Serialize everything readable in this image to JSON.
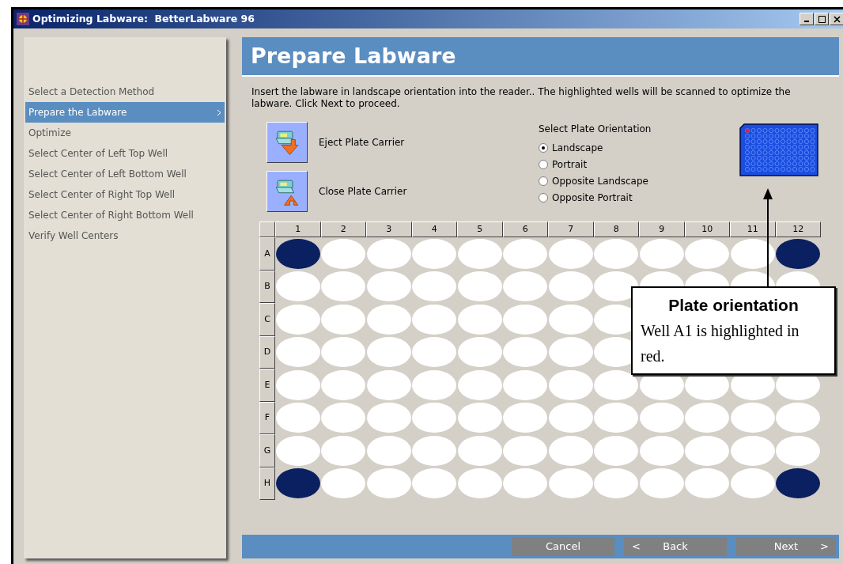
{
  "window": {
    "title": "Optimizing Labware:  BetterLabware 96"
  },
  "steps": [
    {
      "label": "Select a Detection Method",
      "selected": false
    },
    {
      "label": "Prepare the Labware",
      "selected": true
    },
    {
      "label": "Optimize",
      "selected": false
    },
    {
      "label": "Select Center of Left Top Well",
      "selected": false
    },
    {
      "label": "Select Center of Left Bottom Well",
      "selected": false
    },
    {
      "label": "Select Center of Right Top Well",
      "selected": false
    },
    {
      "label": "Select Center of Right Bottom Well",
      "selected": false
    },
    {
      "label": "Verify Well Centers",
      "selected": false
    }
  ],
  "page": {
    "title": "Prepare Labware",
    "instructions": "Insert the labware in landscape orientation into the reader..  The highlighted wells will be scanned to optimize the labware.  Click Next to proceed."
  },
  "carrier_buttons": [
    {
      "kind": "eject",
      "label": "Eject Plate Carrier"
    },
    {
      "kind": "close",
      "label": "Close Plate Carrier"
    }
  ],
  "orientation": {
    "title": "Select Plate Orientation",
    "options": [
      {
        "label": "Landscape",
        "selected": true
      },
      {
        "label": "Portrait",
        "selected": false
      },
      {
        "label": "Opposite Landscape",
        "selected": false
      },
      {
        "label": "Opposite Portrait",
        "selected": false
      }
    ]
  },
  "plate": {
    "columns": [
      "1",
      "2",
      "3",
      "4",
      "5",
      "6",
      "7",
      "8",
      "9",
      "10",
      "11",
      "12"
    ],
    "rows": [
      {
        "label": "A",
        "wells": [
          {
            "selected": true
          },
          {
            "selected": false
          },
          {
            "selected": false
          },
          {
            "selected": false
          },
          {
            "selected": false
          },
          {
            "selected": false
          },
          {
            "selected": false
          },
          {
            "selected": false
          },
          {
            "selected": false
          },
          {
            "selected": false
          },
          {
            "selected": false
          },
          {
            "selected": true
          }
        ]
      },
      {
        "label": "B",
        "wells": [
          {
            "selected": false
          },
          {
            "selected": false
          },
          {
            "selected": false
          },
          {
            "selected": false
          },
          {
            "selected": false
          },
          {
            "selected": false
          },
          {
            "selected": false
          },
          {
            "selected": false
          },
          {
            "selected": false
          },
          {
            "selected": false
          },
          {
            "selected": false
          },
          {
            "selected": false
          }
        ]
      },
      {
        "label": "C",
        "wells": [
          {
            "selected": false
          },
          {
            "selected": false
          },
          {
            "selected": false
          },
          {
            "selected": false
          },
          {
            "selected": false
          },
          {
            "selected": false
          },
          {
            "selected": false
          },
          {
            "selected": false
          }
        ]
      },
      {
        "label": "D",
        "wells": [
          {
            "selected": false
          },
          {
            "selected": false
          },
          {
            "selected": false
          },
          {
            "selected": false
          },
          {
            "selected": false
          },
          {
            "selected": false
          },
          {
            "selected": false
          },
          {
            "selected": false
          }
        ]
      },
      {
        "label": "E",
        "wells": [
          {
            "selected": false
          },
          {
            "selected": false
          },
          {
            "selected": false
          },
          {
            "selected": false
          },
          {
            "selected": false
          },
          {
            "selected": false
          },
          {
            "selected": false
          },
          {
            "selected": false
          },
          {
            "selected": false
          },
          {
            "selected": false
          },
          {
            "selected": false
          },
          {
            "selected": false
          }
        ]
      },
      {
        "label": "F",
        "wells": [
          {
            "selected": false
          },
          {
            "selected": false
          },
          {
            "selected": false
          },
          {
            "selected": false
          },
          {
            "selected": false
          },
          {
            "selected": false
          },
          {
            "selected": false
          },
          {
            "selected": false
          },
          {
            "selected": false
          },
          {
            "selected": false
          },
          {
            "selected": false
          },
          {
            "selected": false
          }
        ]
      },
      {
        "label": "G",
        "wells": [
          {
            "selected": false
          },
          {
            "selected": false
          },
          {
            "selected": false
          },
          {
            "selected": false
          },
          {
            "selected": false
          },
          {
            "selected": false
          },
          {
            "selected": false
          },
          {
            "selected": false
          },
          {
            "selected": false
          },
          {
            "selected": false
          },
          {
            "selected": false
          },
          {
            "selected": false
          }
        ]
      },
      {
        "label": "H",
        "wells": [
          {
            "selected": true
          },
          {
            "selected": false
          },
          {
            "selected": false
          },
          {
            "selected": false
          },
          {
            "selected": false
          },
          {
            "selected": false
          },
          {
            "selected": false
          },
          {
            "selected": false
          },
          {
            "selected": false
          },
          {
            "selected": false
          },
          {
            "selected": false
          },
          {
            "selected": true
          }
        ]
      }
    ]
  },
  "callout": {
    "title": "Plate orientation",
    "text": "Well A1 is highlighted in red."
  },
  "footer": {
    "cancel": "Cancel",
    "back_arrow": "<",
    "back": "Back",
    "next": "Next",
    "next_arrow": ">"
  }
}
